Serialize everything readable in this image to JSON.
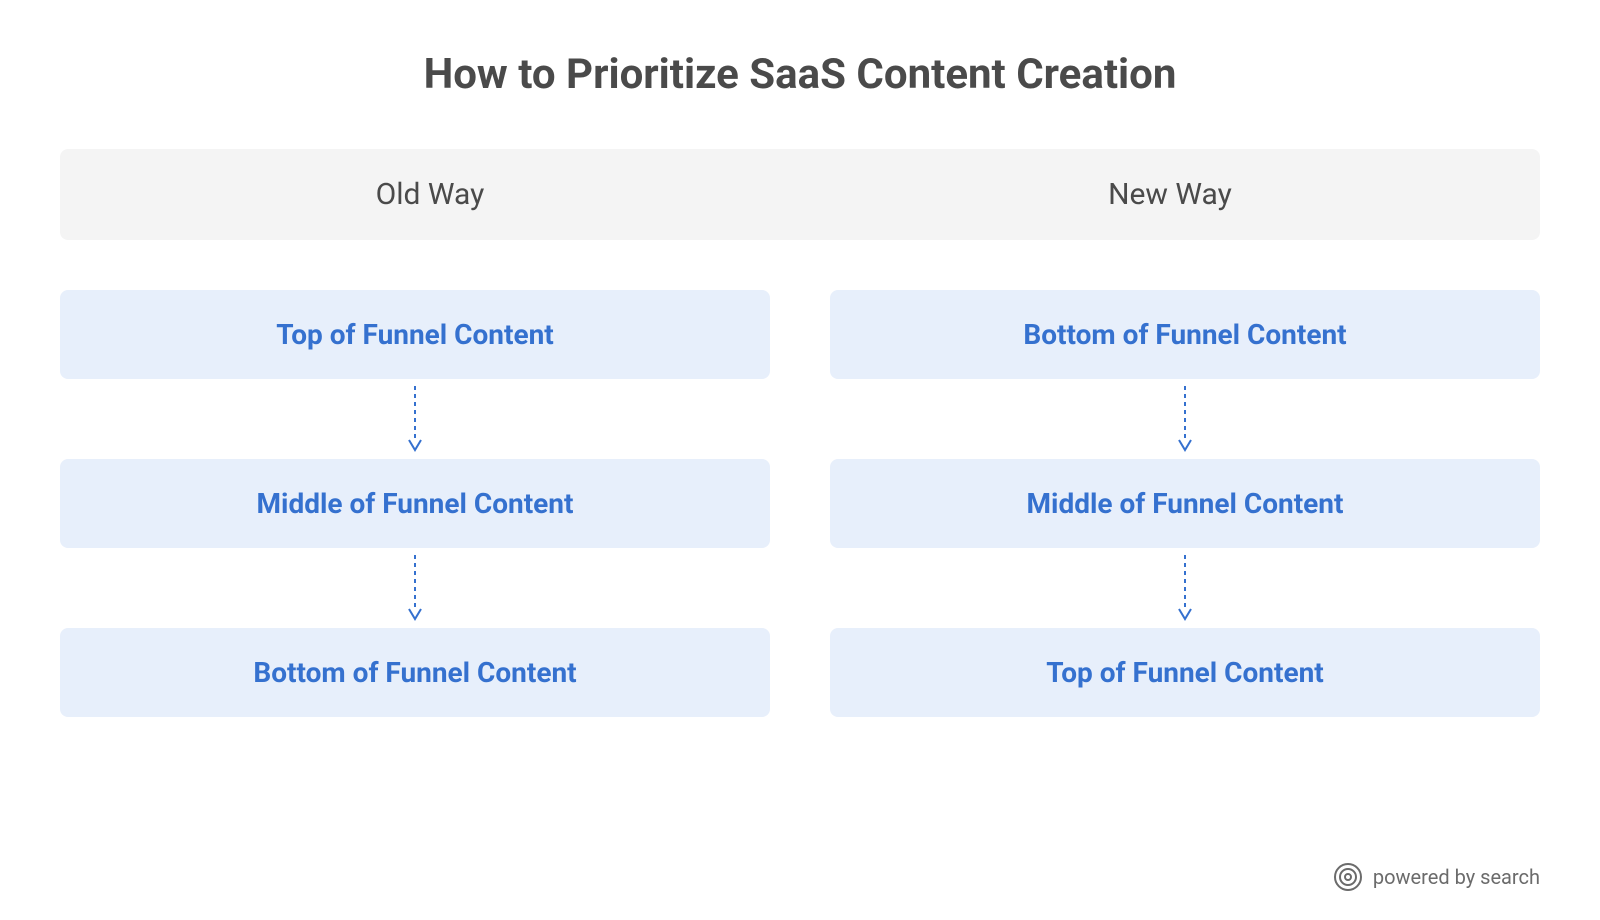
{
  "title": "How to Prioritize SaaS Content Creation",
  "columns": {
    "left": {
      "header": "Old Way",
      "stages": [
        "Top of Funnel Content",
        "Middle of Funnel Content",
        "Bottom of Funnel Content"
      ]
    },
    "right": {
      "header": "New Way",
      "stages": [
        "Bottom of Funnel Content",
        "Middle of Funnel Content",
        "Top of Funnel Content"
      ]
    }
  },
  "footer": {
    "brand": "powered by search"
  },
  "colors": {
    "stage_bg": "#e7effb",
    "stage_text": "#3571cf",
    "header_bg": "#f4f4f4",
    "title_text": "#4a4a4a"
  }
}
